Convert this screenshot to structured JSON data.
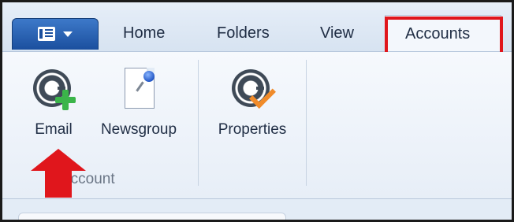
{
  "ribbon": {
    "tabs": [
      "Home",
      "Folders",
      "View",
      "Accounts"
    ],
    "active_tab": "Accounts",
    "commands": {
      "email_label": "Email",
      "newsgroup_label": "Newsgroup",
      "properties_label": "Properties"
    },
    "group_label": "w Account"
  },
  "icons": {
    "app_menu": "app-menu-icon",
    "email": "email-add-icon",
    "newsgroup": "newsgroup-icon",
    "properties": "properties-icon",
    "arrow": "red-up-arrow"
  },
  "colors": {
    "highlight": "#e0161c",
    "app_button": "#1b4f9e",
    "plus": "#3bb54a",
    "check": "#f08b2a"
  }
}
